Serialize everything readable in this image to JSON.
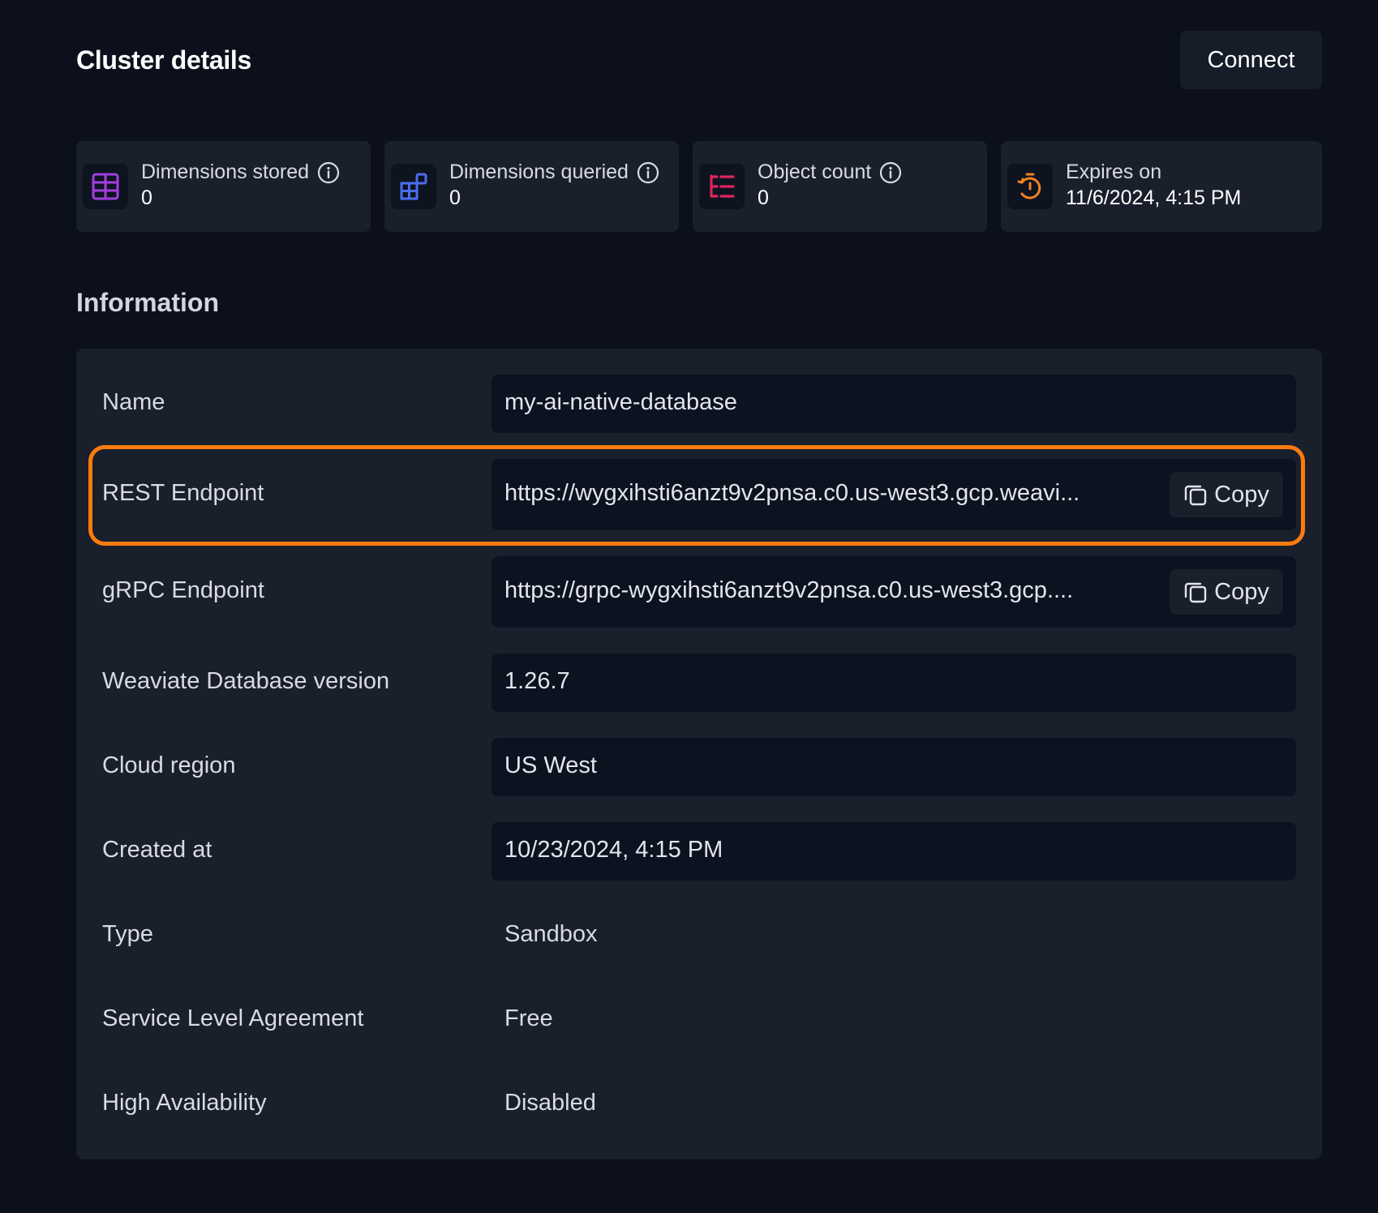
{
  "header": {
    "title": "Cluster details",
    "connect_label": "Connect"
  },
  "stats": [
    {
      "label": "Dimensions stored",
      "value": "0",
      "icon": "table-grid-icon",
      "color": "#a13fe0"
    },
    {
      "label": "Dimensions queried",
      "value": "0",
      "icon": "blocks-icon",
      "color": "#4a6cf0"
    },
    {
      "label": "Object count",
      "value": "0",
      "icon": "list-tree-icon",
      "color": "#e0245e"
    },
    {
      "label": "Expires on",
      "value": "11/6/2024, 4:15 PM",
      "icon": "timer-icon",
      "color": "#f5821f"
    }
  ],
  "information": {
    "title": "Information",
    "rows": [
      {
        "label": "Name",
        "value": "my-ai-native-database"
      },
      {
        "label": "REST Endpoint",
        "value": "https://wygxihsti6anzt9v2pnsa.c0.us-west3.gcp.weavi...",
        "copy_label": "Copy"
      },
      {
        "label": "gRPC Endpoint",
        "value": "https://grpc-wygxihsti6anzt9v2pnsa.c0.us-west3.gcp....",
        "copy_label": "Copy"
      },
      {
        "label": "Weaviate Database version",
        "value": "1.26.7"
      },
      {
        "label": "Cloud region",
        "value": "US West"
      },
      {
        "label": "Created at",
        "value": "10/23/2024, 4:15 PM"
      },
      {
        "label": "Type",
        "value": "Sandbox"
      },
      {
        "label": "Service Level Agreement",
        "value": "Free"
      },
      {
        "label": "High Availability",
        "value": "Disabled"
      }
    ]
  },
  "colors": {
    "highlight": "#ff7a0d",
    "background": "#0b101c",
    "panel": "#1a1f2c"
  }
}
